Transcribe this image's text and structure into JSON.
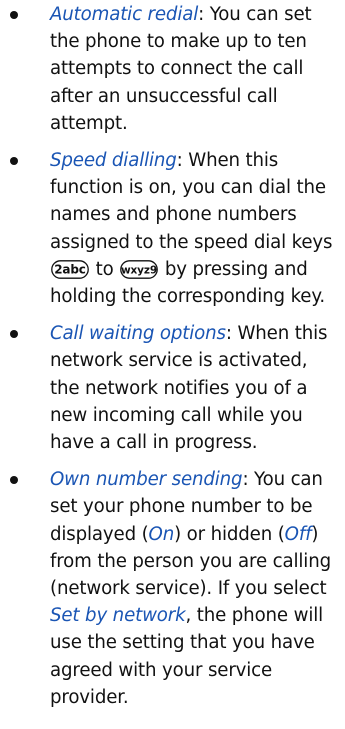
{
  "items": [
    {
      "term": "Automatic redial",
      "text": ": You can set the phone to make up to ten attempts to connect the call after an unsuccessful call attempt."
    },
    {
      "term": "Speed dialling",
      "text_a": ": When this function is on, you can dial the names and phone numbers assigned to the speed dial keys ",
      "key_start": "2abc",
      "text_b": " to ",
      "key_end": "wxyz9",
      "text_c": " by pressing and holding the corresponding key."
    },
    {
      "term": "Call waiting options",
      "text": ": When this network service is activated, the network notifies you of a new incoming call while you have a call in progress."
    },
    {
      "term": "Own number sending",
      "text_a": ": You can set your phone number to be displayed (",
      "opt_on": "On",
      "text_b": ") or hidden (",
      "opt_off": "Off",
      "text_c": ") from the person you are calling (network service). If you select ",
      "opt_network": "Set by network",
      "text_d": ", the phone will use the setting that you have agreed with your service provider."
    }
  ],
  "colors": {
    "term": "#1a55b4",
    "text": "#111111"
  },
  "icons": {
    "key_start": "keypad-2-key-icon",
    "key_end": "keypad-9-key-icon"
  }
}
